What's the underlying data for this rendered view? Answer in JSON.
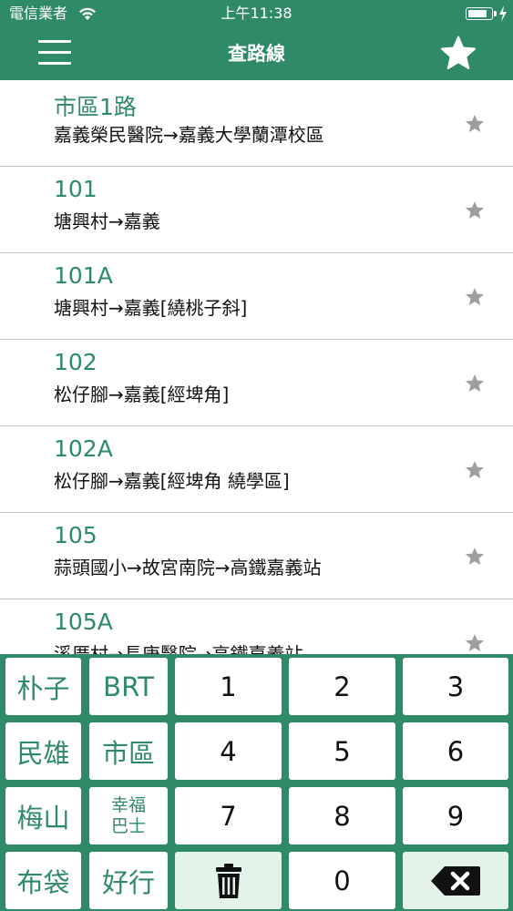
{
  "status": {
    "carrier": "電信業者",
    "time": "上午11:38",
    "battery_level_fraction": 0.88
  },
  "nav": {
    "title": "查路線",
    "left_icon": "hamburger-menu-icon",
    "right_icon": "star-icon"
  },
  "routes": [
    {
      "number": "市區1路",
      "destination": "嘉義榮民醫院→嘉義大學蘭潭校區"
    },
    {
      "number": "101",
      "destination": "塘興村→嘉義"
    },
    {
      "number": "101A",
      "destination": "塘興村→嘉義[繞桃子斜]"
    },
    {
      "number": "102",
      "destination": "松仔腳→嘉義[經埤角]"
    },
    {
      "number": "102A",
      "destination": "松仔腳→嘉義[經埤角 繞學區]"
    },
    {
      "number": "105",
      "destination": "蒜頭國小→故宮南院→高鐵嘉義站"
    },
    {
      "number": "105A",
      "destination": "溪厝村→長庚醫院→高鐵嘉義站"
    }
  ],
  "keypad": {
    "side_keys": [
      [
        "朴子",
        "BRT"
      ],
      [
        "民雄",
        "市區"
      ],
      [
        "梅山",
        "幸福\n巴士"
      ],
      [
        "布袋",
        "好行"
      ]
    ],
    "number_keys": [
      "1",
      "2",
      "3",
      "4",
      "5",
      "6",
      "7",
      "8",
      "9"
    ],
    "zero_key": "0",
    "clear_icon": "trash-icon",
    "backspace_icon": "backspace-icon"
  },
  "colors": {
    "primary": "#2f8a68",
    "favorite_star": "#9e9e9e",
    "key_bg": "#ffffff",
    "key_special_bg": "#e3f3e9"
  }
}
